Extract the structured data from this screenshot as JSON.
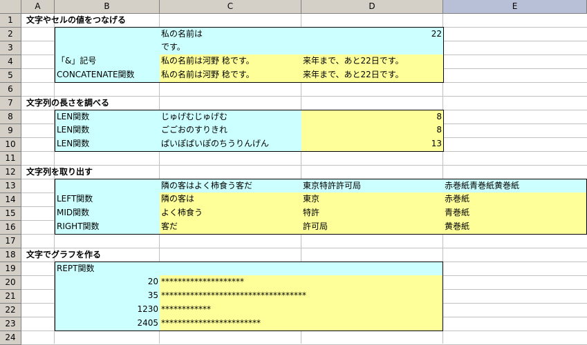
{
  "columns": [
    "A",
    "B",
    "C",
    "D",
    "E"
  ],
  "rows": [
    "1",
    "2",
    "3",
    "4",
    "5",
    "6",
    "7",
    "8",
    "9",
    "10",
    "11",
    "12",
    "13",
    "14",
    "15",
    "16",
    "17",
    "18",
    "19",
    "20",
    "21",
    "22",
    "23",
    "24"
  ],
  "section1": {
    "title": "文字やセルの値をつなげる",
    "c2": "私の名前は",
    "d2": "22",
    "c3": "です。",
    "b4": "「&」記号",
    "c4": "私の名前は河野 稔です。",
    "d4": "来年まで、あと22日です。",
    "b5": "CONCATENATE関数",
    "c5": "私の名前は河野 稔です。",
    "d5": "来年まで、あと22日です。"
  },
  "section2": {
    "title": "文字列の長さを調べる",
    "b8": "LEN関数",
    "c8": "じゅげむじゅげむ",
    "d8": "8",
    "b9": "LEN関数",
    "c9": "ごごおのすりきれ",
    "d9": "8",
    "b10": "LEN関数",
    "c10": "ぱいぽぱいぽのちうりんげん",
    "d10": "13"
  },
  "section3": {
    "title": "文字列を取り出す",
    "c13": "隣の客はよく柿食う客だ",
    "d13": "東京特許許可局",
    "e13": "赤巻紙青巻紙黄巻紙",
    "b14": "LEFT関数",
    "c14": "隣の客は",
    "d14": "東京",
    "e14": "赤巻紙",
    "b15": "MID関数",
    "c15": "よく柿食う",
    "d15": "特許",
    "e15": "青巻紙",
    "b16": "RIGHT関数",
    "c16": "客だ",
    "d16": "許可局",
    "e16": "黄巻紙"
  },
  "section4": {
    "title": "文字でグラフを作る",
    "b19": "REPT関数",
    "b20": "20",
    "c20": "********************",
    "b21": "35",
    "c21": "***********************************",
    "b22": "1230",
    "c22": "************",
    "b23": "2405",
    "c23": "************************"
  },
  "colors": {
    "cyan": "#ccffff",
    "yellow": "#ffff99",
    "header": "#d4d0c8",
    "selected_header": "#b8c0d8"
  }
}
